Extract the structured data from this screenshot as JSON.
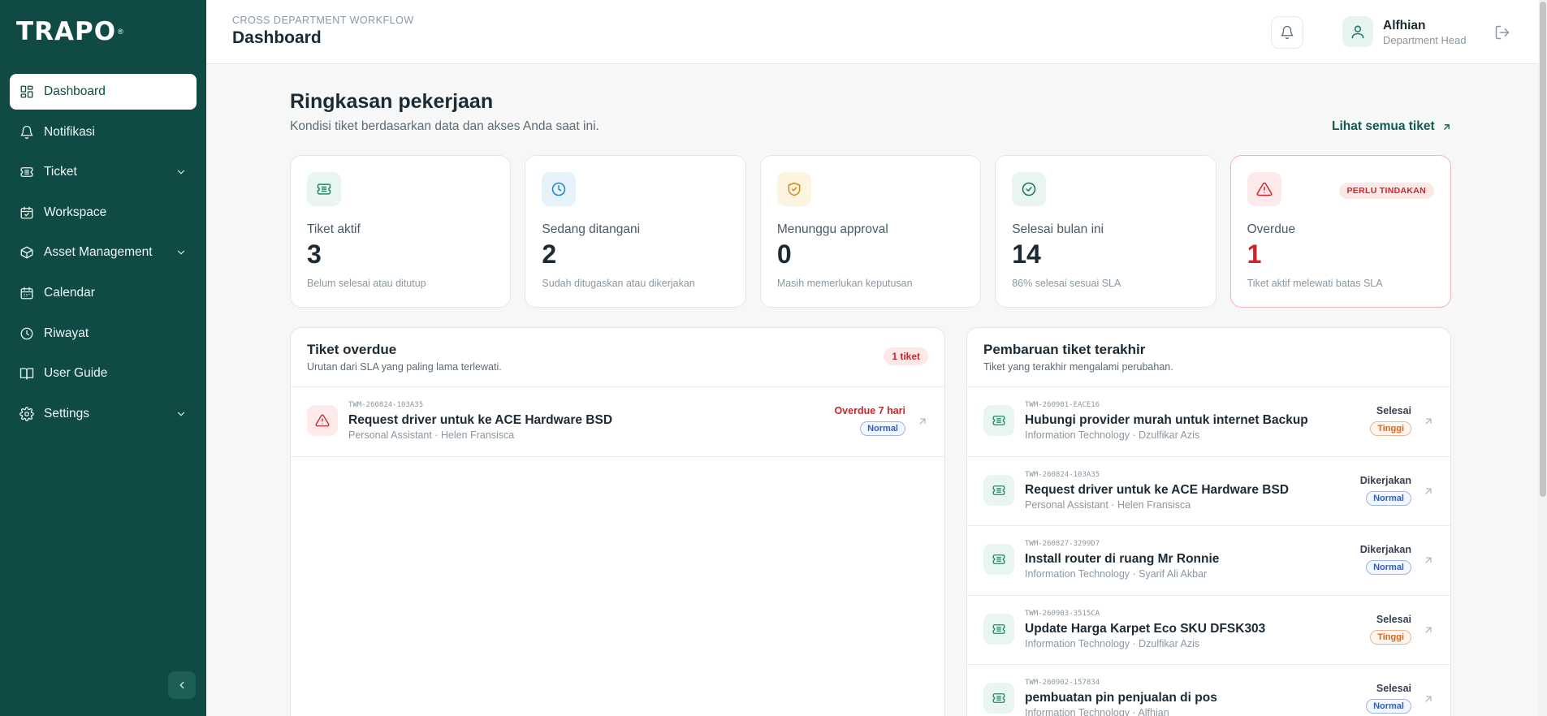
{
  "brand": {
    "logo_text": "TRAPO",
    "logo_mark": "®"
  },
  "sidebar": {
    "items": [
      {
        "label": "Dashboard",
        "icon": "dashboard-grid-icon",
        "active": true,
        "has_children": false
      },
      {
        "label": "Notifikasi",
        "icon": "bell-icon",
        "active": false,
        "has_children": false
      },
      {
        "label": "Ticket",
        "icon": "ticket-icon",
        "active": false,
        "has_children": true
      },
      {
        "label": "Workspace",
        "icon": "calendar-check-icon",
        "active": false,
        "has_children": false
      },
      {
        "label": "Asset Management",
        "icon": "package-icon",
        "active": false,
        "has_children": true
      },
      {
        "label": "Calendar",
        "icon": "calendar-icon",
        "active": false,
        "has_children": false
      },
      {
        "label": "Riwayat",
        "icon": "clock-icon",
        "active": false,
        "has_children": false
      },
      {
        "label": "User Guide",
        "icon": "book-open-icon",
        "active": false,
        "has_children": false
      },
      {
        "label": "Settings",
        "icon": "gear-icon",
        "active": false,
        "has_children": true
      }
    ]
  },
  "header": {
    "eyebrow": "CROSS DEPARTMENT WORKFLOW",
    "title": "Dashboard",
    "user": {
      "name": "Alfhian",
      "role": "Department Head"
    }
  },
  "summary": {
    "title": "Ringkasan pekerjaan",
    "subtitle": "Kondisi tiket berdasarkan data dan akses Anda saat ini.",
    "see_all": "Lihat semua tiket",
    "cards": [
      {
        "label": "Tiket aktif",
        "value": "3",
        "note": "Belum selesai atau ditutup",
        "icon": "ticket-icon",
        "icon_color": "#1f8a6f",
        "icon_bg": "#e8f5f0"
      },
      {
        "label": "Sedang ditangani",
        "value": "2",
        "note": "Sudah ditugaskan atau dikerjakan",
        "icon": "clock-icon",
        "icon_color": "#1d86c4",
        "icon_bg": "#e6f3fb"
      },
      {
        "label": "Menunggu approval",
        "value": "0",
        "note": "Masih memerlukan keputusan",
        "icon": "shield-check-icon",
        "icon_color": "#d08a12",
        "icon_bg": "#fdf3e1"
      },
      {
        "label": "Selesai bulan ini",
        "value": "14",
        "note": "86% selesai sesuai SLA",
        "icon": "check-circle-icon",
        "icon_color": "#1f6f5f",
        "icon_bg": "#e8f5f0"
      },
      {
        "label": "Overdue",
        "value": "1",
        "note": "Tiket aktif melewati batas SLA",
        "icon": "alert-triangle-icon",
        "icon_color": "#d2232a",
        "icon_bg": "#fdeaea",
        "badge": "PERLU TINDAKAN"
      }
    ]
  },
  "overdue": {
    "title": "Tiket overdue",
    "subtitle": "Urutan dari SLA yang paling lama terlewati.",
    "count_badge": "1 tiket",
    "rows": [
      {
        "code": "TWM-260824-103A35",
        "title": "Request driver untuk ke ACE Hardware BSD",
        "meta": "Personal Assistant · Helen Fransisca",
        "status": "Overdue 7 hari",
        "priority": "Normal"
      }
    ]
  },
  "updates": {
    "title": "Pembaruan tiket terakhir",
    "subtitle": "Tiket yang terakhir mengalami perubahan.",
    "rows": [
      {
        "code": "TWM-260901-EACE16",
        "title": "Hubungi provider murah untuk internet Backup",
        "meta": "Information Technology · Dzulfikar Azis",
        "status": "Selesai",
        "priority": "Tinggi"
      },
      {
        "code": "TWM-260824-103A35",
        "title": "Request driver untuk ke ACE Hardware BSD",
        "meta": "Personal Assistant · Helen Fransisca",
        "status": "Dikerjakan",
        "priority": "Normal"
      },
      {
        "code": "TWM-260827-3299D7",
        "title": "Install router di ruang Mr Ronnie",
        "meta": "Information Technology · Syarif Ali Akbar",
        "status": "Dikerjakan",
        "priority": "Normal"
      },
      {
        "code": "TWM-260903-3515CA",
        "title": "Update Harga Karpet Eco SKU DFSK303",
        "meta": "Information Technology · Dzulfikar Azis",
        "status": "Selesai",
        "priority": "Tinggi"
      },
      {
        "code": "TWM-260902-157834",
        "title": "pembuatan pin penjualan di pos",
        "meta": "Information Technology · Alfhian",
        "status": "Selesai",
        "priority": "Normal"
      }
    ]
  }
}
